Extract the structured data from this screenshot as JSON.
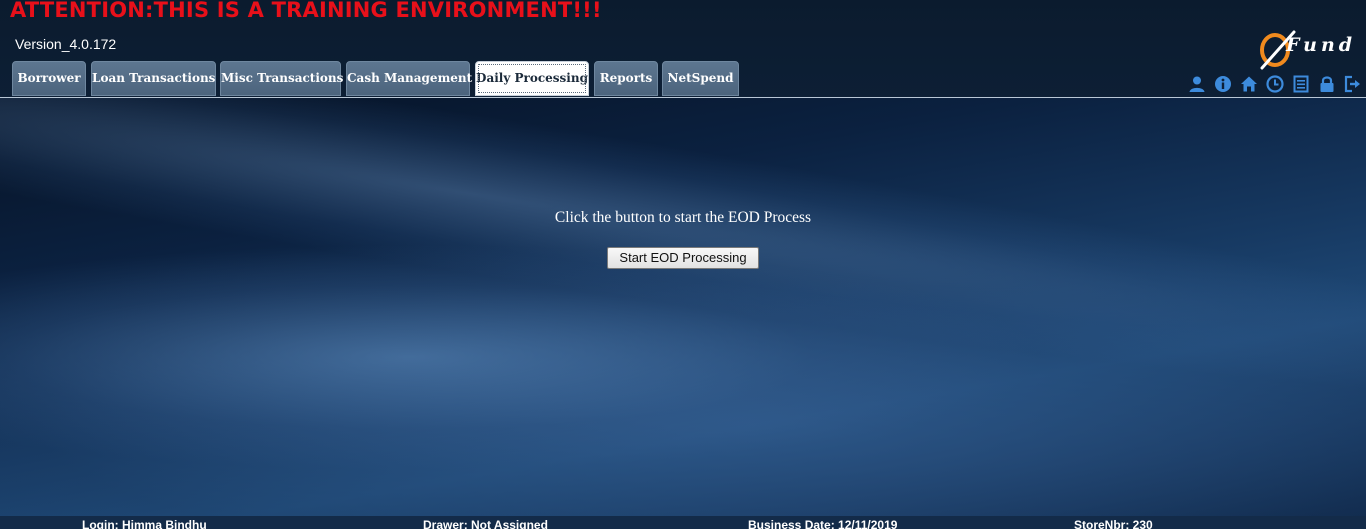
{
  "header": {
    "attention_banner": "ATTENTION:THIS IS A TRAINING ENVIRONMENT!!!",
    "version": "Version_4.0.172",
    "logo_text": "Fund",
    "colors": {
      "banner": "#e8101a",
      "logo_accent": "#f08a1e",
      "icon_blue": "#3d8bdc"
    }
  },
  "tabs": [
    {
      "label": "Borrower",
      "active": false
    },
    {
      "label": "Loan Transactions",
      "active": false
    },
    {
      "label": "Misc Transactions",
      "active": false
    },
    {
      "label": "Cash Management",
      "active": false
    },
    {
      "label": "Daily Processing",
      "active": true
    },
    {
      "label": "Reports",
      "active": false
    },
    {
      "label": "NetSpend",
      "active": false
    }
  ],
  "toolbar_icons": [
    "user-icon",
    "info-icon",
    "home-icon",
    "clock-icon",
    "notes-icon",
    "lock-icon",
    "logout-icon"
  ],
  "main": {
    "prompt": "Click the button to start the EOD Process",
    "start_button": "Start EOD Processing"
  },
  "footer": {
    "login": "Login: Himma Bindhu",
    "drawer": "Drawer: Not Assigned",
    "business_date": "Business Date: 12/11/2019",
    "store": "StoreNbr: 230"
  }
}
